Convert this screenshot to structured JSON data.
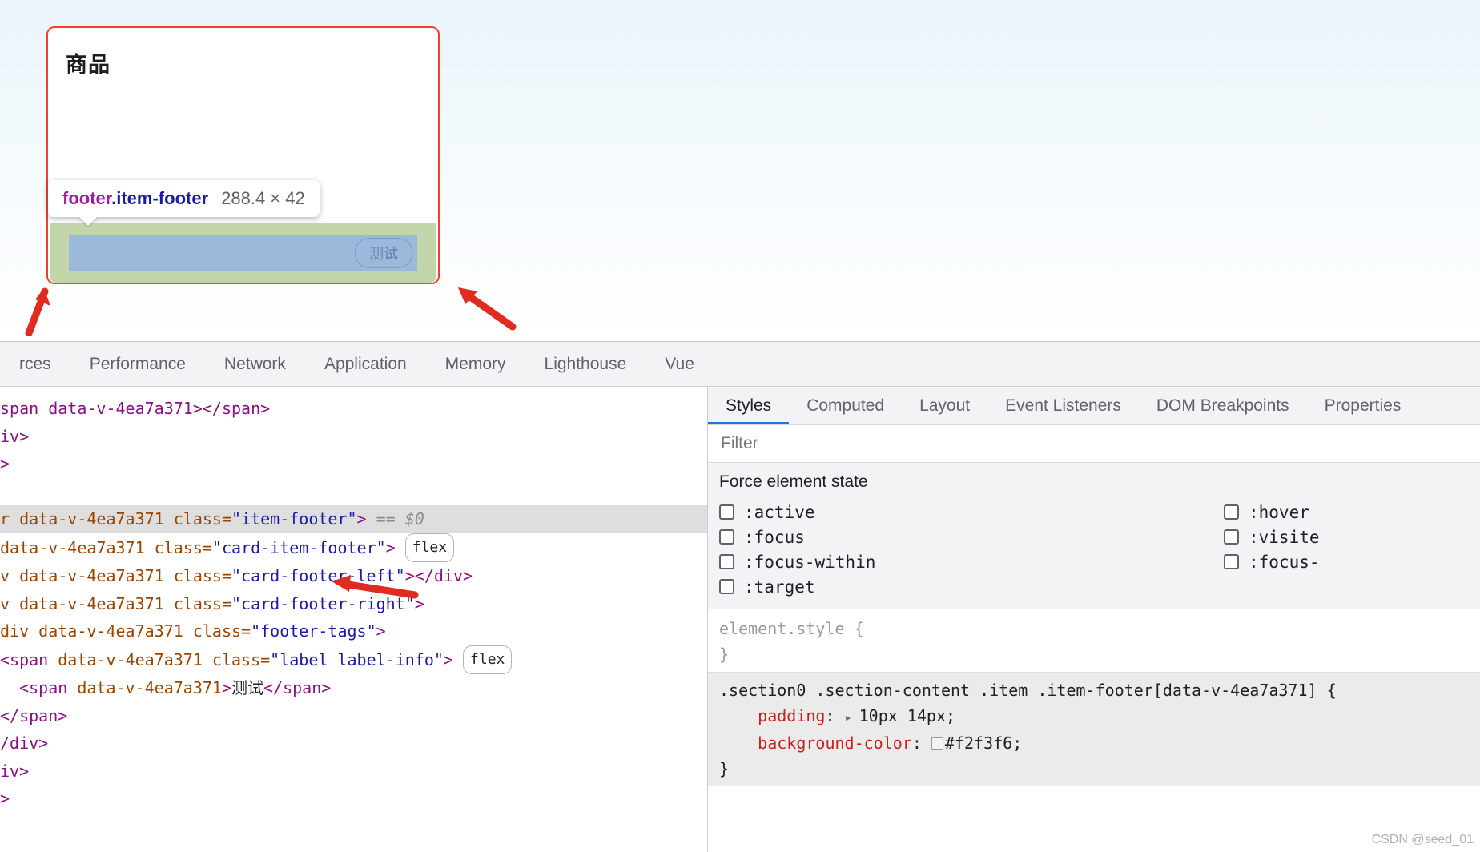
{
  "page": {
    "card_title": "商品",
    "footer_tag_label": "测试"
  },
  "inspector_tooltip": {
    "tag": "footer",
    "class": ".item-footer",
    "dimensions": "288.4 × 42"
  },
  "devtools": {
    "tabs": [
      {
        "label": "rces",
        "active": false
      },
      {
        "label": "Performance",
        "active": false
      },
      {
        "label": "Network",
        "active": false
      },
      {
        "label": "Application",
        "active": false
      },
      {
        "label": "Memory",
        "active": false
      },
      {
        "label": "Lighthouse",
        "active": false
      },
      {
        "label": "Vue",
        "active": false
      }
    ],
    "dom_lines": [
      {
        "id": "l0",
        "html": "<span class=\"tag\">span data-v-4ea7a371&gt;&lt;/span&gt;</span>",
        "selected": false
      },
      {
        "id": "l1",
        "html": "<span class=\"tag\">iv&gt;</span>",
        "selected": false
      },
      {
        "id": "l2",
        "html": "<span class=\"tag\">&gt;</span>",
        "selected": false
      },
      {
        "id": "l3",
        "html": "",
        "selected": false
      },
      {
        "id": "l4",
        "html": "<span class=\"attr\">r data-v-4ea7a371 class=</span><span class=\"val\">\"item-footer\"</span><span class=\"tag\">&gt;</span> <span class=\"dollar\">== $0</span>",
        "selected": true
      },
      {
        "id": "l5",
        "html": "<span class=\"attr\">data-v-4ea7a371 class=</span><span class=\"val\">\"card-item-footer\"</span><span class=\"tag\">&gt;</span> <span class=\"badge-flex\">flex</span>",
        "selected": false
      },
      {
        "id": "l6",
        "html": "<span class=\"attr\">v data-v-4ea7a371 class=</span><span class=\"val\">\"card-footer-left\"</span><span class=\"tag\">&gt;&lt;/div&gt;</span>",
        "selected": false
      },
      {
        "id": "l7",
        "html": "<span class=\"attr\">v data-v-4ea7a371 class=</span><span class=\"val\">\"card-footer-right\"</span><span class=\"tag\">&gt;</span>",
        "selected": false
      },
      {
        "id": "l8",
        "html": "<span class=\"attr\">div data-v-4ea7a371 class=</span><span class=\"val\">\"footer-tags\"</span><span class=\"tag\">&gt;</span>",
        "selected": false
      },
      {
        "id": "l9",
        "html": "<span class=\"tag\">&lt;span</span><span class=\"attr\"> data-v-4ea7a371 class=</span><span class=\"val\">\"label label-info\"</span><span class=\"tag\">&gt;</span> <span class=\"badge-flex\">flex</span>",
        "selected": false
      },
      {
        "id": "l10",
        "html": "  <span class=\"tag\">&lt;span</span><span class=\"attr\"> data-v-4ea7a371</span><span class=\"tag\">&gt;</span><span class=\"txt\">测试</span><span class=\"tag\">&lt;/span&gt;</span>",
        "selected": false
      },
      {
        "id": "l11",
        "html": "<span class=\"tag\">&lt;/span&gt;</span>",
        "selected": false
      },
      {
        "id": "l12",
        "html": "<span class=\"tag\">/div&gt;</span>",
        "selected": false
      },
      {
        "id": "l13",
        "html": "<span class=\"tag\">iv&gt;</span>",
        "selected": false
      },
      {
        "id": "l14",
        "html": "<span class=\"tag\">&gt;</span>",
        "selected": false
      }
    ],
    "styles": {
      "tabs": [
        {
          "label": "Styles",
          "active": true
        },
        {
          "label": "Computed",
          "active": false
        },
        {
          "label": "Layout",
          "active": false
        },
        {
          "label": "Event Listeners",
          "active": false
        },
        {
          "label": "DOM Breakpoints",
          "active": false
        },
        {
          "label": "Properties",
          "active": false
        }
      ],
      "filter_placeholder": "Filter",
      "force_state_title": "Force element state",
      "force_states_left": [
        ":active",
        ":focus",
        ":focus-within",
        ":target"
      ],
      "force_states_right": [
        ":hover",
        ":visite",
        ":focus-"
      ],
      "element_style": {
        "open": "element.style {",
        "close": "}"
      },
      "rule": {
        "selector": ".section0 .section-content .item .item-footer[data-v-4ea7a371] {",
        "declarations": [
          {
            "name": "padding",
            "value": "10px 14px;",
            "has_disclosure": true,
            "swatch": null
          },
          {
            "name": "background-color",
            "value": "#f2f3f6;",
            "has_disclosure": false,
            "swatch": "#f2f3f6"
          }
        ],
        "close": "}"
      }
    }
  },
  "watermark": "CSDN @seed_01",
  "colors": {
    "card_border": "#f04030",
    "overlay_padding": "#c3d6ab",
    "overlay_content": "#9cb8da",
    "accent_blue": "#1a73e8",
    "annotation_red": "#e02b20",
    "swatch_bg": "#f2f3f6"
  }
}
